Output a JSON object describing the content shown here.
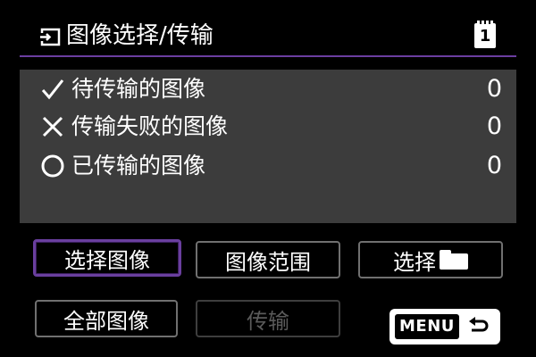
{
  "header": {
    "title": "图像选择/传输",
    "card_slot": "1",
    "transfer_icon": "image-transfer-icon"
  },
  "status": {
    "items": [
      {
        "icon": "check-icon",
        "label": "待传输的图像",
        "count": "0"
      },
      {
        "icon": "cross-icon",
        "label": "传输失败的图像",
        "count": "0"
      },
      {
        "icon": "circle-icon",
        "label": "已传输的图像",
        "count": "0"
      }
    ]
  },
  "buttons": {
    "select_images": "选择图像",
    "image_range": "图像范围",
    "select_folder": "选择",
    "all_images": "全部图像",
    "transfer": "传输",
    "menu": "MENU"
  },
  "colors": {
    "accent": "#6a3f9f",
    "panel": "#3c3c3c",
    "disabled_text": "#5a5a5a"
  }
}
